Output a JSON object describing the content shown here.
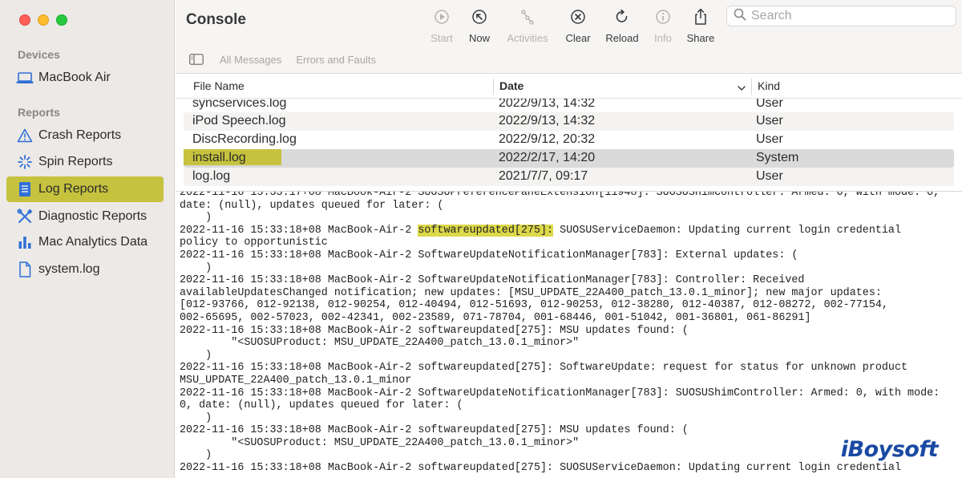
{
  "sidebar": {
    "devices_label": "Devices",
    "device_name": "MacBook Air",
    "reports_label": "Reports",
    "items": [
      {
        "label": "Crash Reports",
        "icon": "warning-icon"
      },
      {
        "label": "Spin Reports",
        "icon": "spinner-icon"
      },
      {
        "label": "Log Reports",
        "icon": "document-icon",
        "selected": true
      },
      {
        "label": "Diagnostic Reports",
        "icon": "tools-icon"
      },
      {
        "label": "Mac Analytics Data",
        "icon": "bar-chart-icon"
      },
      {
        "label": "system.log",
        "icon": "file-icon"
      }
    ]
  },
  "toolbar": {
    "title": "Console",
    "start": "Start",
    "now": "Now",
    "activities": "Activities",
    "clear": "Clear",
    "reload": "Reload",
    "info": "Info",
    "share": "Share",
    "search_placeholder": "Search",
    "filter_all": "All Messages",
    "filter_errors": "Errors and Faults"
  },
  "table": {
    "columns": [
      "File Name",
      "Date",
      "Kind"
    ],
    "rows": [
      {
        "name": "syncservices.log",
        "date": "2022/9/13, 14:32",
        "kind": "User"
      },
      {
        "name": "iPod Speech.log",
        "date": "2022/9/13, 14:32",
        "kind": "User"
      },
      {
        "name": "DiscRecording.log",
        "date": "2022/9/12, 20:32",
        "kind": "User"
      },
      {
        "name": "install.log",
        "date": "2022/2/17, 14:20",
        "kind": "System"
      },
      {
        "name": "log.log",
        "date": "2021/7/7, 09:17",
        "kind": "User"
      }
    ]
  },
  "log": {
    "l1": "2022-11-16 15:33:17+08 MacBook-Air-2 SUOSUPreferencePaneExtension[11948]: SUOSUShimController: Armed: 0, with mode: 0,\ndate: (null), updates queued for later: (\n    )\n2022-11-16 15:33:18+08 MacBook-Air-2 ",
    "hl": "softwareupdated[275]:",
    "l2": " SUOSUServiceDaemon: Updating current login credential\npolicy to opportunistic\n2022-11-16 15:33:18+08 MacBook-Air-2 SoftwareUpdateNotificationManager[783]: External updates: (\n    )\n2022-11-16 15:33:18+08 MacBook-Air-2 SoftwareUpdateNotificationManager[783]: Controller: Received\navailableUpdatesChanged notification; new updates: [MSU_UPDATE_22A400_patch_13.0.1_minor]; new major updates:\n[012-93766, 012-92138, 012-90254, 012-40494, 012-51693, 012-90253, 012-38280, 012-40387, 012-08272, 002-77154,\n002-65695, 002-57023, 002-42341, 002-23589, 071-78704, 001-68446, 001-51042, 001-36801, 061-86291]\n2022-11-16 15:33:18+08 MacBook-Air-2 softwareupdated[275]: MSU updates found: (\n        \"<SUOSUProduct: MSU_UPDATE_22A400_patch_13.0.1_minor>\"\n    )\n2022-11-16 15:33:18+08 MacBook-Air-2 softwareupdated[275]: SoftwareUpdate: request for status for unknown product\nMSU_UPDATE_22A400_patch_13.0.1_minor\n2022-11-16 15:33:18+08 MacBook-Air-2 SoftwareUpdateNotificationManager[783]: SUOSUShimController: Armed: 0, with mode:\n0, date: (null), updates queued for later: (\n    )\n2022-11-16 15:33:18+08 MacBook-Air-2 softwareupdated[275]: MSU updates found: (\n        \"<SUOSUProduct: MSU_UPDATE_22A400_patch_13.0.1_minor>\"\n    )\n2022-11-16 15:33:18+08 MacBook-Air-2 softwareupdated[275]: SUOSUServiceDaemon: Updating current login credential"
  },
  "watermark": "iBoysoft",
  "colors": {
    "selection_highlight": "#c6c23e",
    "log_highlight": "#dcd84a",
    "watermark": "#1a4aa3"
  }
}
